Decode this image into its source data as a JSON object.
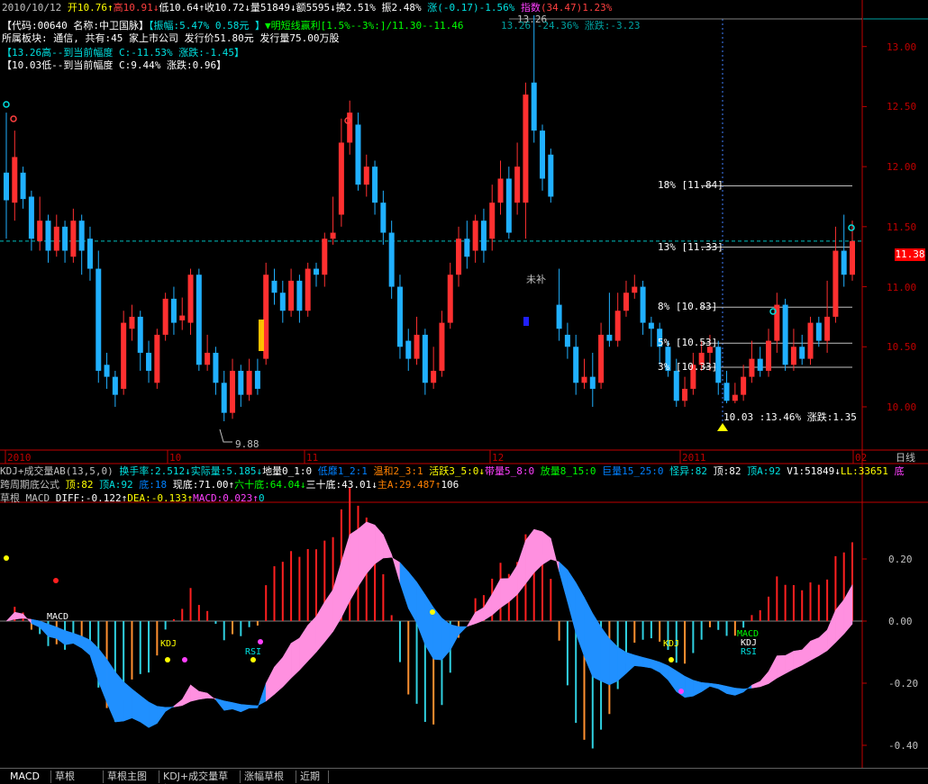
{
  "header": {
    "line1": [
      {
        "text": "2010/10/12",
        "color": "#c0c0c0"
      },
      {
        "text": " 开10.76↑",
        "color": "#ffff00"
      },
      {
        "text": "高10.91↓",
        "color": "#ff4040"
      },
      {
        "text": "低10.64↑",
        "color": "#ffffff"
      },
      {
        "text": "收10.72↓",
        "color": "#ffffff"
      },
      {
        "text": "量51849↓",
        "color": "#ffffff"
      },
      {
        "text": "额5595↓",
        "color": "#ffffff"
      },
      {
        "text": "换2.51%",
        "color": "#ffffff"
      },
      {
        "text": " 振2.48%",
        "color": "#ffffff"
      },
      {
        "text": " 涨(-0.17)-1.56%",
        "color": "#00e0e0"
      },
      {
        "text": " 指数",
        "color": "#ff40ff"
      },
      {
        "text": "(34.47)1.23%",
        "color": "#ff4040"
      }
    ],
    "line2": [
      {
        "text": "【代码:00640 名称:中卫国脉】",
        "color": "#ffffff"
      },
      {
        "text": "【振幅:5.47% 0.58元 】",
        "color": "#00e0e0"
      },
      {
        "text": "▼明短线赢利[1.5%--3%:]/11.30--11.46",
        "color": "#00ff00"
      }
    ],
    "line3": [
      {
        "text": " 所属板块: 通信, 共有:45 家上市公司  发行价51.80元  发行量75.00万股",
        "color": "#ffffff"
      }
    ],
    "line4": [
      {
        "text": "【13.26高--到当前幅度 C:-11.53%  涨跌:-1.45】",
        "color": "#00e0e0"
      }
    ],
    "line5": [
      {
        "text": "【10.03低--到当前幅度 C:9.44%  涨跌:0.96】",
        "color": "#ffffff"
      }
    ],
    "high_note": "13.26",
    "high_note2": "13.26 -24.36%  涨跌:-3.23",
    "low_note": "10.03  :13.46%  涨跌:1.35",
    "weiba": "未补",
    "low_val": "9.88"
  },
  "fib_levels": [
    {
      "pct": "18%",
      "price": "[11.84]",
      "value": 11.84
    },
    {
      "pct": "13%",
      "price": "[11.33]",
      "value": 11.33
    },
    {
      "pct": "8%",
      "price": "[10.83]",
      "value": 10.83
    },
    {
      "pct": "5%",
      "price": "[10.53]",
      "value": 10.53
    },
    {
      "pct": "3%",
      "price": "[10.33]",
      "value": 10.33
    }
  ],
  "price_axis": {
    "ticks": [
      "13.00",
      "12.50",
      "12.00",
      "11.50",
      "11.00",
      "10.50",
      "10.00"
    ],
    "current": "11.38",
    "period": "日线"
  },
  "date_axis": [
    "2010",
    "10",
    "11",
    "12",
    "2011",
    "02"
  ],
  "indicator_line1": [
    {
      "text": "KDJ+成交量AB(13,5,0)",
      "color": "#c0c0c0"
    },
    {
      "text": " 换手率:2.512↓",
      "color": "#00e0e0"
    },
    {
      "text": "实际量:5.185↓",
      "color": "#00e0e0"
    },
    {
      "text": "地量0_1:0",
      "color": "#ffffff"
    },
    {
      "text": " 低靡1_2:1",
      "color": "#0080ff"
    },
    {
      "text": " 温和2_3:1",
      "color": "#ff8000"
    },
    {
      "text": " 活跃3_5:0↓",
      "color": "#ffff00"
    },
    {
      "text": "带量5_8:0",
      "color": "#ff40ff"
    },
    {
      "text": " 放量8_15:0",
      "color": "#00ff00"
    },
    {
      "text": " 巨量15_25:0",
      "color": "#0080ff"
    },
    {
      "text": " 怪异:82",
      "color": "#00e0e0"
    },
    {
      "text": " 顶:82",
      "color": "#ffffff"
    },
    {
      "text": " 顶A:92",
      "color": "#00e0e0"
    },
    {
      "text": "  V1:51849↓",
      "color": "#ffffff"
    },
    {
      "text": "LL:33651",
      "color": "#ffff00"
    },
    {
      "text": " 底",
      "color": "#ff40ff"
    }
  ],
  "indicator_line2": [
    {
      "text": "跨周期底公式",
      "color": "#c0c0c0"
    },
    {
      "text": " 顶:82",
      "color": "#ffff00"
    },
    {
      "text": " 顶A:92",
      "color": "#00e0e0"
    },
    {
      "text": " 底:18",
      "color": "#0080ff"
    },
    {
      "text": " 现底:71.00↑",
      "color": "#ffffff"
    },
    {
      "text": "六十底:64.04↓",
      "color": "#00ff00"
    },
    {
      "text": "三十底:43.01↓",
      "color": "#ffffff"
    },
    {
      "text": "主A:29.487↑",
      "color": "#ff8000"
    },
    {
      "text": "106",
      "color": "#ffffff"
    }
  ],
  "macd_header": [
    {
      "text": "草根 MACD",
      "color": "#c0c0c0"
    },
    {
      "text": " DIFF:-0.122↑",
      "color": "#ffffff"
    },
    {
      "text": "DEA:-0.133↑",
      "color": "#ffff00"
    },
    {
      "text": "MACD:0.023↑",
      "color": "#ff40ff"
    },
    {
      "text": "0",
      "color": "#00e0e0"
    }
  ],
  "macd_axis": [
    "0.20",
    "0.00",
    "-0.20",
    "-0.40"
  ],
  "macd_labels": {
    "macd": "MACD",
    "kdj1": "KDJ",
    "rsi1": "RSI",
    "kdj2": "KDJ",
    "macd2": "MACD",
    "kdj3": "KDJ",
    "rsi2": "RSI"
  },
  "tabs": [
    "MACD",
    "草根 MACD",
    "草根主图用",
    "KDJ+成交量草根",
    "涨幅草根",
    "近期"
  ],
  "colors": {
    "up": "#ff3030",
    "down": "#20b0ff",
    "grid": "#800000",
    "axis": "#c00000"
  },
  "chart_data": {
    "type": "candlestick",
    "ylim": [
      9.7,
      13.35
    ],
    "candles": [
      [
        11.95,
        11.72,
        12.45,
        11.4
      ],
      [
        11.7,
        12.08,
        12.3,
        11.55
      ],
      [
        11.95,
        11.73,
        12.0,
        11.65
      ],
      [
        11.75,
        11.4,
        11.8,
        11.3
      ],
      [
        11.38,
        11.55,
        11.75,
        11.3
      ],
      [
        11.55,
        11.3,
        11.6,
        11.2
      ],
      [
        11.3,
        11.5,
        11.6,
        11.25
      ],
      [
        11.5,
        11.3,
        11.55,
        11.2
      ],
      [
        11.25,
        11.55,
        11.65,
        11.2
      ],
      [
        11.55,
        11.3,
        11.6,
        11.1
      ],
      [
        11.4,
        11.15,
        11.5,
        11.05
      ],
      [
        11.15,
        10.3,
        11.3,
        10.2
      ],
      [
        10.35,
        10.25,
        10.45,
        10.15
      ],
      [
        10.25,
        10.1,
        10.3,
        10.0
      ],
      [
        10.15,
        10.7,
        10.8,
        10.1
      ],
      [
        10.65,
        10.75,
        10.85,
        10.55
      ],
      [
        10.75,
        10.45,
        10.8,
        10.3
      ],
      [
        10.45,
        10.3,
        10.55,
        10.2
      ],
      [
        10.2,
        10.6,
        10.65,
        10.15
      ],
      [
        10.6,
        10.9,
        10.95,
        10.55
      ],
      [
        10.9,
        10.7,
        11.0,
        10.6
      ],
      [
        10.72,
        10.76,
        10.91,
        10.64
      ],
      [
        10.7,
        11.1,
        11.15,
        10.6
      ],
      [
        11.1,
        10.35,
        11.15,
        10.3
      ],
      [
        10.35,
        10.45,
        10.6,
        10.3
      ],
      [
        10.45,
        10.2,
        10.5,
        10.1
      ],
      [
        10.2,
        9.95,
        10.3,
        9.88
      ],
      [
        9.95,
        10.3,
        10.4,
        9.9
      ],
      [
        10.3,
        10.1,
        10.35,
        10.0
      ],
      [
        10.1,
        10.3,
        10.4,
        10.05
      ],
      [
        10.3,
        10.15,
        10.4,
        10.1
      ],
      [
        10.4,
        11.1,
        11.2,
        10.35
      ],
      [
        11.05,
        10.95,
        11.15,
        10.85
      ],
      [
        10.95,
        10.8,
        11.05,
        10.7
      ],
      [
        10.8,
        11.05,
        11.15,
        10.75
      ],
      [
        11.05,
        10.8,
        11.1,
        10.7
      ],
      [
        10.8,
        11.15,
        11.2,
        10.75
      ],
      [
        11.15,
        11.1,
        11.2,
        11.0
      ],
      [
        11.1,
        11.4,
        11.45,
        11.0
      ],
      [
        11.4,
        11.45,
        11.75,
        11.35
      ],
      [
        11.6,
        12.2,
        12.4,
        11.5
      ],
      [
        12.2,
        12.45,
        12.55,
        12.1
      ],
      [
        12.35,
        11.85,
        12.45,
        11.8
      ],
      [
        11.85,
        12.0,
        12.1,
        11.75
      ],
      [
        12.0,
        11.7,
        12.05,
        11.6
      ],
      [
        11.7,
        11.45,
        11.8,
        11.35
      ],
      [
        11.45,
        11.0,
        11.55,
        10.9
      ],
      [
        11.0,
        10.5,
        11.1,
        10.4
      ],
      [
        10.55,
        10.4,
        10.65,
        10.3
      ],
      [
        10.4,
        10.6,
        10.75,
        10.35
      ],
      [
        10.6,
        10.2,
        10.65,
        10.1
      ],
      [
        10.2,
        10.3,
        10.5,
        10.15
      ],
      [
        10.3,
        10.7,
        10.8,
        10.25
      ],
      [
        10.7,
        11.1,
        11.2,
        10.65
      ],
      [
        11.1,
        11.4,
        11.5,
        11.0
      ],
      [
        11.4,
        11.25,
        11.55,
        11.15
      ],
      [
        11.3,
        11.55,
        11.6,
        11.2
      ],
      [
        11.55,
        11.3,
        11.65,
        11.2
      ],
      [
        11.4,
        11.7,
        11.85,
        11.3
      ],
      [
        11.7,
        11.9,
        12.05,
        11.6
      ],
      [
        11.9,
        11.45,
        12.0,
        11.4
      ],
      [
        11.7,
        12.0,
        12.2,
        11.6
      ],
      [
        11.7,
        12.6,
        12.7,
        11.4
      ],
      [
        12.7,
        12.3,
        13.26,
        12.2
      ],
      [
        12.3,
        11.9,
        12.35,
        11.8
      ],
      [
        12.1,
        11.75,
        12.15,
        11.7
      ],
      [
        10.85,
        10.65,
        11.15,
        10.55
      ],
      [
        10.6,
        10.5,
        10.7,
        10.4
      ],
      [
        10.5,
        10.2,
        10.6,
        10.1
      ],
      [
        10.2,
        10.25,
        10.4,
        10.15
      ],
      [
        10.25,
        10.15,
        10.45,
        10.0
      ],
      [
        10.2,
        10.6,
        10.7,
        10.15
      ],
      [
        10.6,
        10.55,
        10.95,
        10.5
      ],
      [
        10.55,
        10.8,
        10.95,
        10.5
      ],
      [
        10.8,
        10.95,
        11.05,
        10.75
      ],
      [
        10.95,
        11.0,
        11.1,
        10.9
      ],
      [
        11.0,
        10.7,
        11.05,
        10.6
      ],
      [
        10.7,
        10.65,
        10.75,
        10.5
      ],
      [
        10.65,
        10.5,
        10.7,
        10.35
      ],
      [
        10.5,
        10.3,
        10.55,
        10.25
      ],
      [
        10.3,
        10.05,
        10.4,
        10.0
      ],
      [
        10.05,
        10.15,
        10.25,
        10.0
      ],
      [
        10.15,
        10.35,
        10.45,
        10.1
      ],
      [
        10.35,
        10.45,
        10.55,
        10.3
      ],
      [
        10.45,
        10.5,
        10.6,
        10.3
      ],
      [
        10.5,
        10.2,
        10.55,
        10.1
      ],
      [
        10.2,
        10.05,
        10.3,
        10.03
      ],
      [
        10.05,
        10.1,
        10.2,
        10.03
      ],
      [
        10.1,
        10.25,
        10.35,
        10.05
      ],
      [
        10.25,
        10.4,
        10.55,
        10.2
      ],
      [
        10.4,
        10.3,
        10.5,
        10.25
      ],
      [
        10.3,
        10.55,
        10.65,
        10.25
      ],
      [
        10.55,
        10.85,
        10.95,
        10.45
      ],
      [
        10.85,
        10.35,
        10.9,
        10.3
      ],
      [
        10.35,
        10.5,
        10.65,
        10.3
      ],
      [
        10.5,
        10.4,
        10.6,
        10.35
      ],
      [
        10.4,
        10.7,
        10.75,
        10.35
      ],
      [
        10.7,
        10.55,
        10.75,
        10.5
      ],
      [
        10.55,
        10.75,
        11.05,
        10.45
      ],
      [
        10.75,
        11.3,
        11.5,
        10.7
      ],
      [
        11.3,
        11.1,
        11.6,
        11.0
      ],
      [
        11.1,
        11.38,
        11.55,
        11.05
      ]
    ]
  }
}
